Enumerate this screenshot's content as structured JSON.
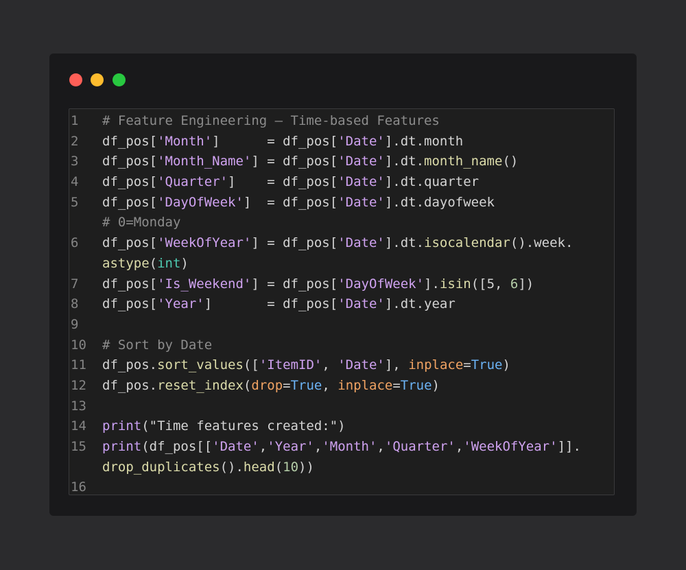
{
  "window": {
    "controls": [
      {
        "name": "close",
        "color": "#fe5f57"
      },
      {
        "name": "minimize",
        "color": "#febc2e"
      },
      {
        "name": "maximize",
        "color": "#28c840"
      }
    ]
  },
  "editor": {
    "language": "python",
    "lines": [
      {
        "n": "1",
        "tokens": [
          {
            "t": "comment",
            "v": "# Feature Engineering — Time-based Features"
          }
        ]
      },
      {
        "n": "2",
        "tokens": [
          {
            "t": "default",
            "v": "df_pos["
          },
          {
            "t": "string",
            "v": "'Month'"
          },
          {
            "t": "default",
            "v": "]      = df_pos["
          },
          {
            "t": "string",
            "v": "'Date'"
          },
          {
            "t": "default",
            "v": "].dt.month"
          }
        ]
      },
      {
        "n": "3",
        "tokens": [
          {
            "t": "default",
            "v": "df_pos["
          },
          {
            "t": "string",
            "v": "'Month_Name'"
          },
          {
            "t": "default",
            "v": "] = df_pos["
          },
          {
            "t": "string",
            "v": "'Date'"
          },
          {
            "t": "default",
            "v": "].dt."
          },
          {
            "t": "method",
            "v": "month_name"
          },
          {
            "t": "default",
            "v": "()"
          }
        ]
      },
      {
        "n": "4",
        "tokens": [
          {
            "t": "default",
            "v": "df_pos["
          },
          {
            "t": "string",
            "v": "'Quarter'"
          },
          {
            "t": "default",
            "v": "]    = df_pos["
          },
          {
            "t": "string",
            "v": "'Date'"
          },
          {
            "t": "default",
            "v": "].dt.quarter"
          }
        ]
      },
      {
        "n": "5",
        "tokens": [
          {
            "t": "default",
            "v": "df_pos["
          },
          {
            "t": "string",
            "v": "'DayOfWeek'"
          },
          {
            "t": "default",
            "v": "]  = df_pos["
          },
          {
            "t": "string",
            "v": "'Date'"
          },
          {
            "t": "default",
            "v": "].dt.dayofweek"
          }
        ]
      },
      {
        "n": "",
        "tokens": [
          {
            "t": "comment",
            "v": "# 0=Monday"
          }
        ]
      },
      {
        "n": "6",
        "tokens": [
          {
            "t": "default",
            "v": "df_pos["
          },
          {
            "t": "string",
            "v": "'WeekOfYear'"
          },
          {
            "t": "default",
            "v": "] = df_pos["
          },
          {
            "t": "string",
            "v": "'Date'"
          },
          {
            "t": "default",
            "v": "].dt."
          },
          {
            "t": "method",
            "v": "isocalendar"
          },
          {
            "t": "default",
            "v": "().week."
          }
        ]
      },
      {
        "n": "",
        "tokens": [
          {
            "t": "method",
            "v": "astype"
          },
          {
            "t": "default",
            "v": "("
          },
          {
            "t": "type",
            "v": "int"
          },
          {
            "t": "default",
            "v": ")"
          }
        ]
      },
      {
        "n": "7",
        "tokens": [
          {
            "t": "default",
            "v": "df_pos["
          },
          {
            "t": "string",
            "v": "'Is_Weekend'"
          },
          {
            "t": "default",
            "v": "] = df_pos["
          },
          {
            "t": "string",
            "v": "'DayOfWeek'"
          },
          {
            "t": "default",
            "v": "]."
          },
          {
            "t": "method",
            "v": "isin"
          },
          {
            "t": "default",
            "v": "([5, "
          },
          {
            "t": "number",
            "v": "6"
          },
          {
            "t": "default",
            "v": "])"
          }
        ]
      },
      {
        "n": "8",
        "tokens": [
          {
            "t": "default",
            "v": "df_pos["
          },
          {
            "t": "string",
            "v": "'Year'"
          },
          {
            "t": "default",
            "v": "]       = df_pos["
          },
          {
            "t": "string",
            "v": "'Date'"
          },
          {
            "t": "default",
            "v": "].dt.year"
          }
        ]
      },
      {
        "n": "9",
        "tokens": []
      },
      {
        "n": "10",
        "tokens": [
          {
            "t": "comment",
            "v": "# Sort by Date"
          }
        ]
      },
      {
        "n": "11",
        "tokens": [
          {
            "t": "default",
            "v": "df_pos."
          },
          {
            "t": "method",
            "v": "sort_values"
          },
          {
            "t": "default",
            "v": "(["
          },
          {
            "t": "string",
            "v": "'ItemID'"
          },
          {
            "t": "default",
            "v": ", "
          },
          {
            "t": "string",
            "v": "'Date'"
          },
          {
            "t": "default",
            "v": "], "
          },
          {
            "t": "param",
            "v": "inplace"
          },
          {
            "t": "default",
            "v": "="
          },
          {
            "t": "keyword",
            "v": "True"
          },
          {
            "t": "default",
            "v": ")"
          }
        ]
      },
      {
        "n": "12",
        "tokens": [
          {
            "t": "default",
            "v": "df_pos."
          },
          {
            "t": "method",
            "v": "reset_index"
          },
          {
            "t": "default",
            "v": "("
          },
          {
            "t": "param",
            "v": "drop"
          },
          {
            "t": "default",
            "v": "="
          },
          {
            "t": "keyword",
            "v": "True"
          },
          {
            "t": "default",
            "v": ", "
          },
          {
            "t": "param",
            "v": "inplace"
          },
          {
            "t": "default",
            "v": "="
          },
          {
            "t": "keyword",
            "v": "True"
          },
          {
            "t": "default",
            "v": ")"
          }
        ]
      },
      {
        "n": "13",
        "tokens": []
      },
      {
        "n": "14",
        "tokens": [
          {
            "t": "builtin",
            "v": "print"
          },
          {
            "t": "default",
            "v": "(\"Time features created:\")"
          }
        ]
      },
      {
        "n": "15",
        "tokens": [
          {
            "t": "builtin",
            "v": "print"
          },
          {
            "t": "default",
            "v": "(df_pos[["
          },
          {
            "t": "string",
            "v": "'Date'"
          },
          {
            "t": "default",
            "v": ","
          },
          {
            "t": "string",
            "v": "'Year'"
          },
          {
            "t": "default",
            "v": ","
          },
          {
            "t": "string",
            "v": "'Month'"
          },
          {
            "t": "default",
            "v": ","
          },
          {
            "t": "string",
            "v": "'Quarter'"
          },
          {
            "t": "default",
            "v": ","
          },
          {
            "t": "string",
            "v": "'WeekOfYear'"
          },
          {
            "t": "default",
            "v": "]]."
          }
        ]
      },
      {
        "n": "",
        "tokens": [
          {
            "t": "method",
            "v": "drop_duplicates"
          },
          {
            "t": "default",
            "v": "()."
          },
          {
            "t": "method",
            "v": "head"
          },
          {
            "t": "default",
            "v": "("
          },
          {
            "t": "number",
            "v": "10"
          },
          {
            "t": "default",
            "v": "))"
          }
        ]
      },
      {
        "n": "16",
        "tokens": []
      }
    ]
  }
}
